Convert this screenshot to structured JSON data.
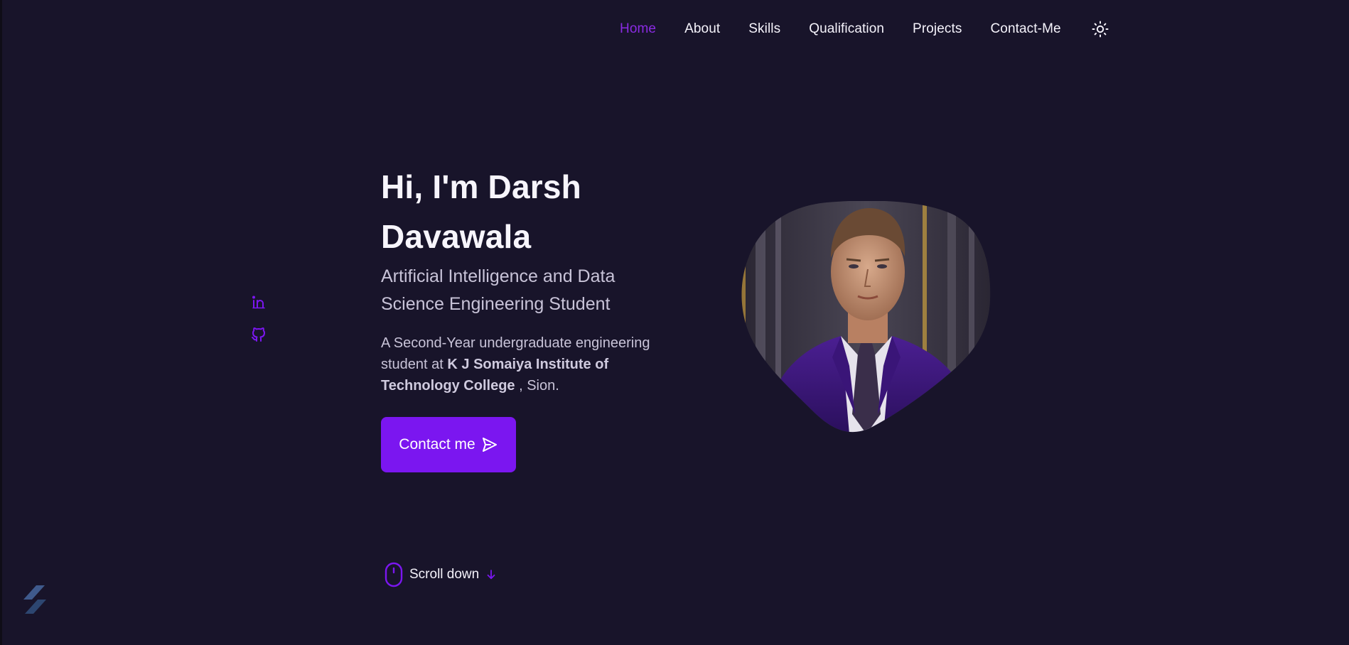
{
  "nav": {
    "items": [
      {
        "label": "Home",
        "active": true
      },
      {
        "label": "About",
        "active": false
      },
      {
        "label": "Skills",
        "active": false
      },
      {
        "label": "Qualification",
        "active": false
      },
      {
        "label": "Projects",
        "active": false
      },
      {
        "label": "Contact-Me",
        "active": false
      }
    ],
    "theme_icon": "sun-icon"
  },
  "social": {
    "items": [
      {
        "icon": "linkedin-icon"
      },
      {
        "icon": "github-icon"
      }
    ]
  },
  "hero": {
    "title_line1": "Hi, I'm Darsh",
    "title_line2": "Davawala",
    "subtitle": "Artificial Intelligence and Data Science Engineering Student",
    "desc_prefix": "A Second-Year undergraduate engineering student at ",
    "desc_bold": "K J Somaiya Institute of Technology College",
    "desc_suffix": " , Sion.",
    "contact_button": "Contact me"
  },
  "scroll": {
    "label": "Scroll down"
  },
  "colors": {
    "accent": "#7b16f0",
    "nav_active": "#8a2be2",
    "background": "#18142a",
    "text": "#f5f3fb",
    "muted_text": "#c8c3d8"
  }
}
